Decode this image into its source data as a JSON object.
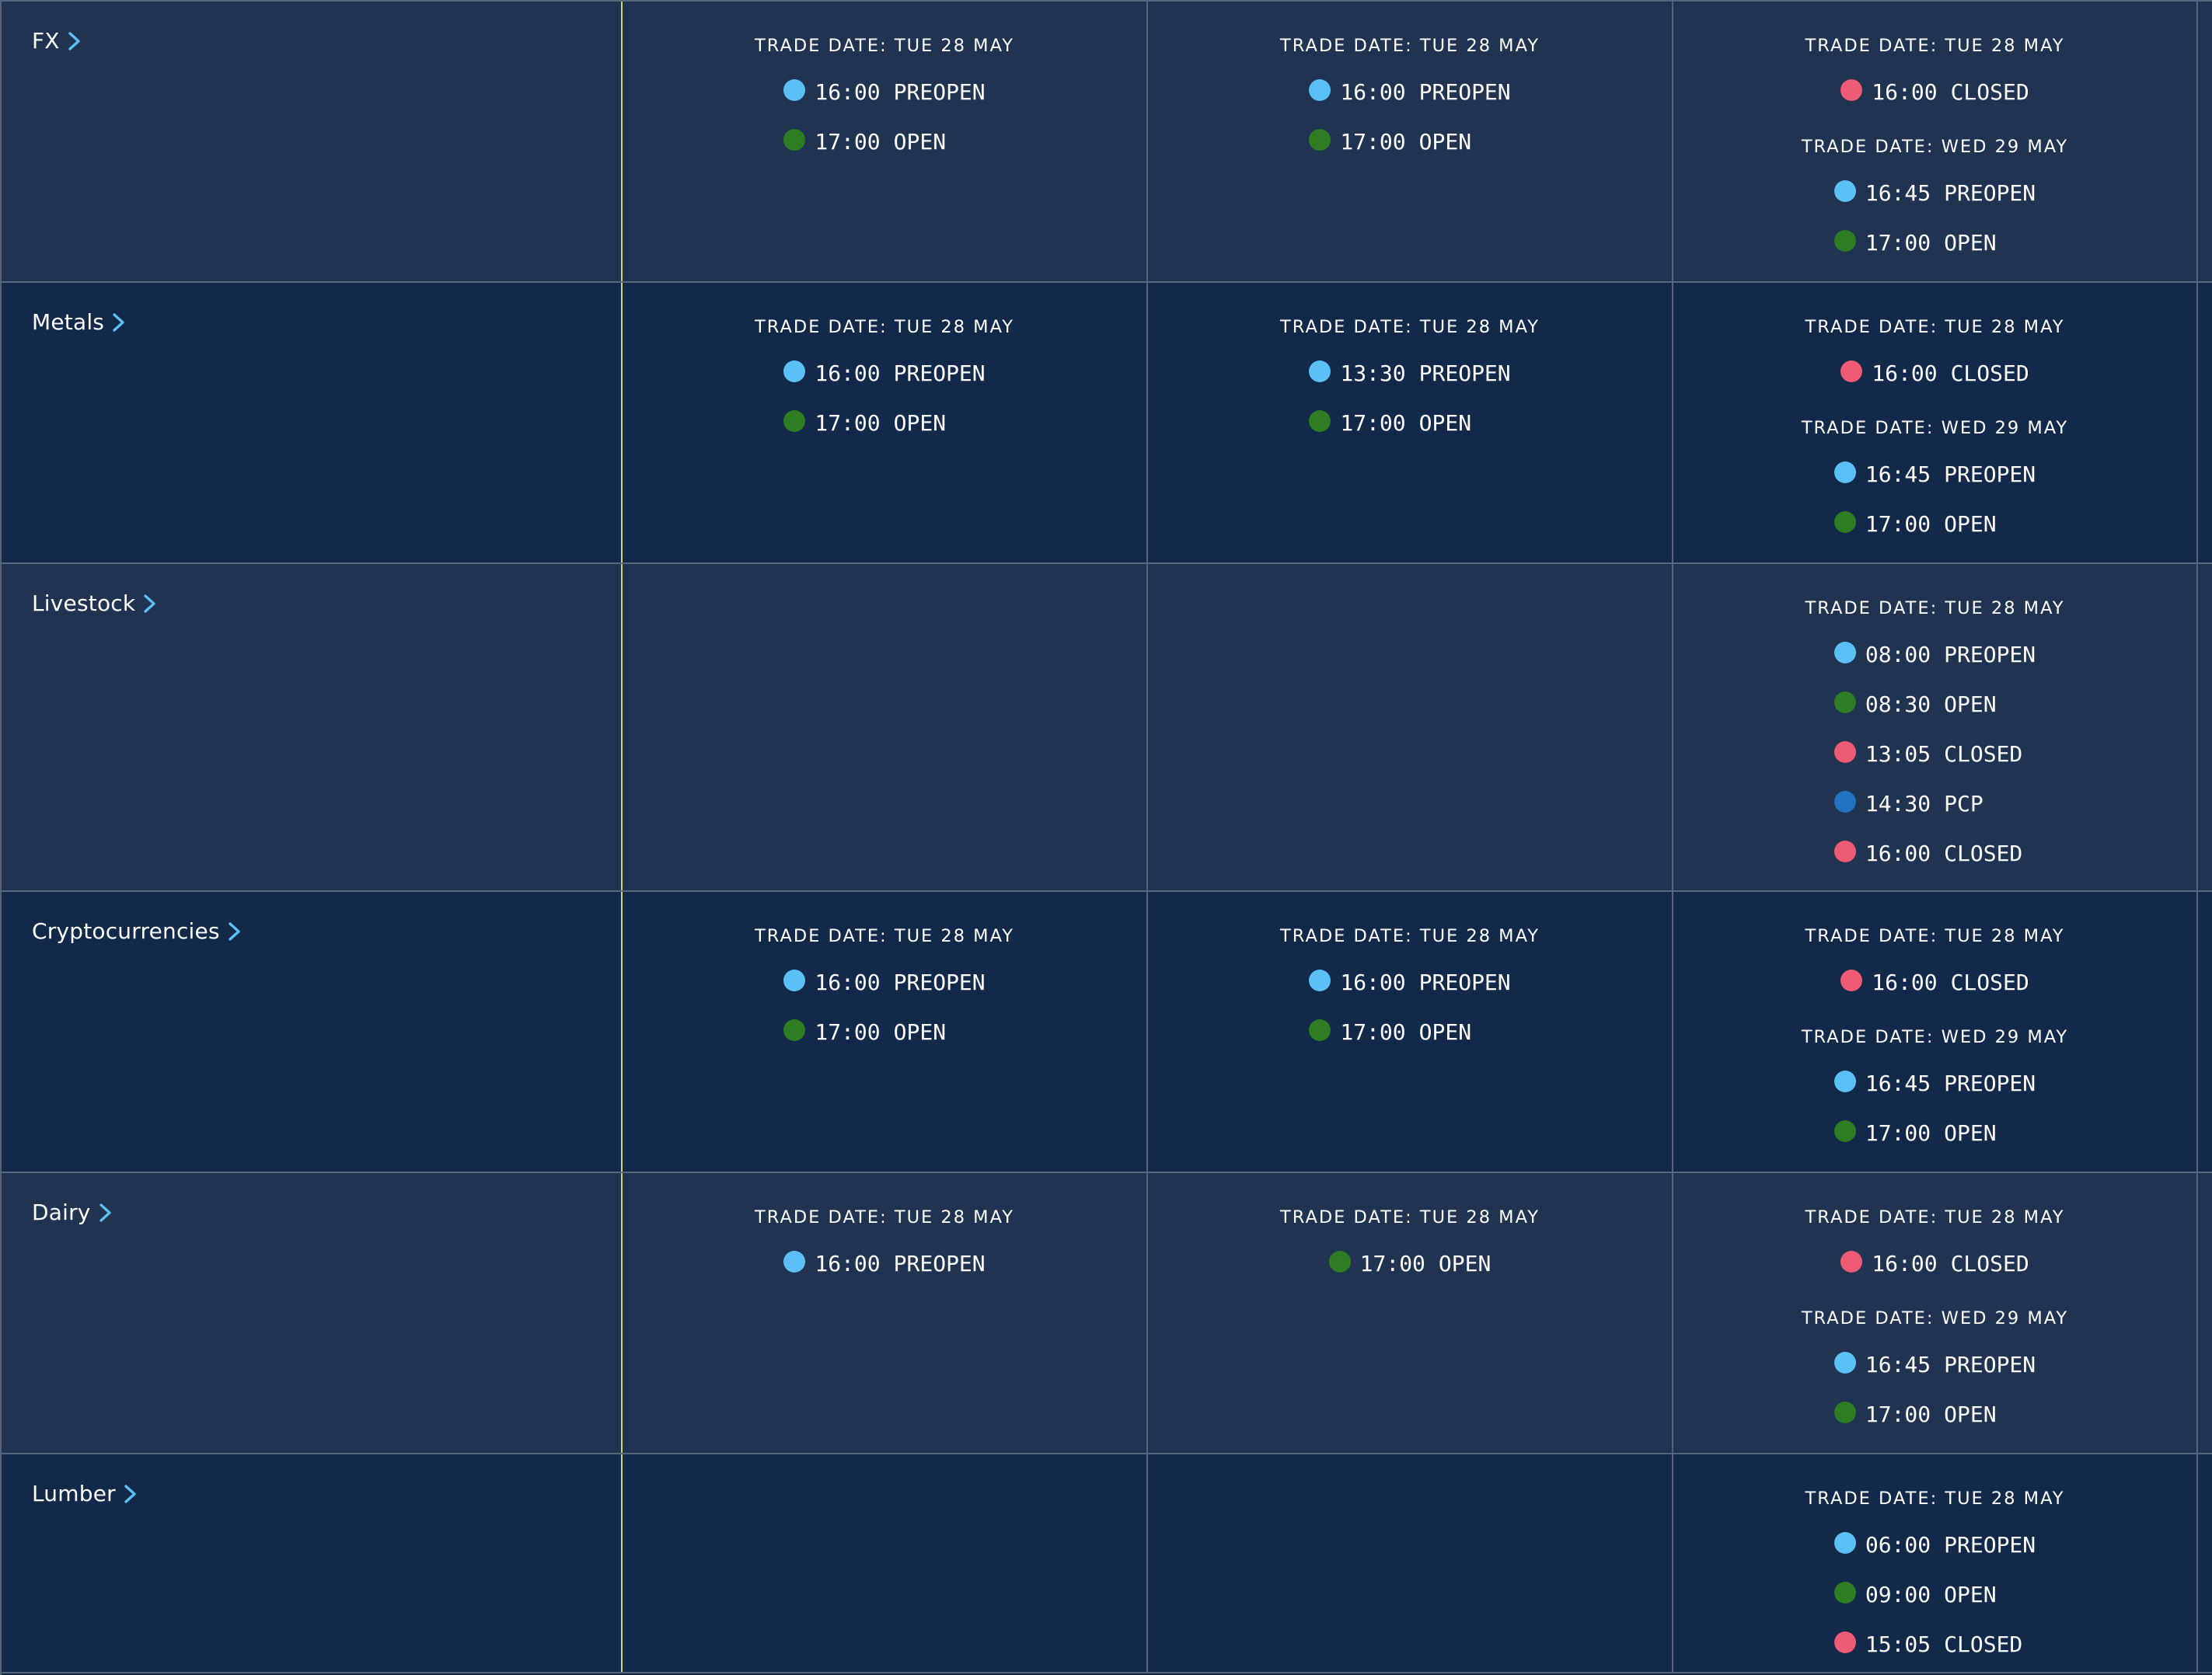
{
  "colors": {
    "PREOPEN": "#5bc0f5",
    "OPEN": "#2e7d22",
    "CLOSED": "#ef5a74",
    "PCP": "#1f73c0",
    "chevron": "#5bc0f5",
    "row_light": "#203351",
    "row_dark": "#13294a"
  },
  "rows": [
    {
      "category": "FX",
      "icon": "chevron-right-icon",
      "columns": [
        [
          {
            "trade_date": "TRADE DATE: TUE 28 MAY",
            "events": [
              {
                "time": "16:00",
                "status": "PREOPEN"
              },
              {
                "time": "17:00",
                "status": "OPEN"
              }
            ]
          }
        ],
        [
          {
            "trade_date": "TRADE DATE: TUE 28 MAY",
            "events": [
              {
                "time": "16:00",
                "status": "PREOPEN"
              },
              {
                "time": "17:00",
                "status": "OPEN"
              }
            ]
          }
        ],
        [
          {
            "trade_date": "TRADE DATE: TUE 28 MAY",
            "events": [
              {
                "time": "16:00",
                "status": "CLOSED"
              }
            ]
          },
          {
            "trade_date": "TRADE DATE: WED 29 MAY",
            "events": [
              {
                "time": "16:45",
                "status": "PREOPEN"
              },
              {
                "time": "17:00",
                "status": "OPEN"
              }
            ]
          }
        ]
      ]
    },
    {
      "category": "Metals",
      "icon": "chevron-right-icon",
      "columns": [
        [
          {
            "trade_date": "TRADE DATE: TUE 28 MAY",
            "events": [
              {
                "time": "16:00",
                "status": "PREOPEN"
              },
              {
                "time": "17:00",
                "status": "OPEN"
              }
            ]
          }
        ],
        [
          {
            "trade_date": "TRADE DATE: TUE 28 MAY",
            "events": [
              {
                "time": "13:30",
                "status": "PREOPEN"
              },
              {
                "time": "17:00",
                "status": "OPEN"
              }
            ]
          }
        ],
        [
          {
            "trade_date": "TRADE DATE: TUE 28 MAY",
            "events": [
              {
                "time": "16:00",
                "status": "CLOSED"
              }
            ]
          },
          {
            "trade_date": "TRADE DATE: WED 29 MAY",
            "events": [
              {
                "time": "16:45",
                "status": "PREOPEN"
              },
              {
                "time": "17:00",
                "status": "OPEN"
              }
            ]
          }
        ]
      ]
    },
    {
      "category": "Livestock",
      "icon": "chevron-right-icon",
      "columns": [
        [],
        [],
        [
          {
            "trade_date": "TRADE DATE: TUE 28 MAY",
            "events": [
              {
                "time": "08:00",
                "status": "PREOPEN"
              },
              {
                "time": "08:30",
                "status": "OPEN"
              },
              {
                "time": "13:05",
                "status": "CLOSED"
              },
              {
                "time": "14:30",
                "status": "PCP"
              },
              {
                "time": "16:00",
                "status": "CLOSED"
              }
            ]
          }
        ]
      ]
    },
    {
      "category": "Cryptocurrencies",
      "icon": "chevron-right-icon",
      "columns": [
        [
          {
            "trade_date": "TRADE DATE: TUE 28 MAY",
            "events": [
              {
                "time": "16:00",
                "status": "PREOPEN"
              },
              {
                "time": "17:00",
                "status": "OPEN"
              }
            ]
          }
        ],
        [
          {
            "trade_date": "TRADE DATE: TUE 28 MAY",
            "events": [
              {
                "time": "16:00",
                "status": "PREOPEN"
              },
              {
                "time": "17:00",
                "status": "OPEN"
              }
            ]
          }
        ],
        [
          {
            "trade_date": "TRADE DATE: TUE 28 MAY",
            "events": [
              {
                "time": "16:00",
                "status": "CLOSED"
              }
            ]
          },
          {
            "trade_date": "TRADE DATE: WED 29 MAY",
            "events": [
              {
                "time": "16:45",
                "status": "PREOPEN"
              },
              {
                "time": "17:00",
                "status": "OPEN"
              }
            ]
          }
        ]
      ]
    },
    {
      "category": "Dairy",
      "icon": "chevron-right-icon",
      "columns": [
        [
          {
            "trade_date": "TRADE DATE: TUE 28 MAY",
            "events": [
              {
                "time": "16:00",
                "status": "PREOPEN"
              }
            ]
          }
        ],
        [
          {
            "trade_date": "TRADE DATE: TUE 28 MAY",
            "events": [
              {
                "time": "17:00",
                "status": "OPEN"
              }
            ]
          }
        ],
        [
          {
            "trade_date": "TRADE DATE: TUE 28 MAY",
            "events": [
              {
                "time": "16:00",
                "status": "CLOSED"
              }
            ]
          },
          {
            "trade_date": "TRADE DATE: WED 29 MAY",
            "events": [
              {
                "time": "16:45",
                "status": "PREOPEN"
              },
              {
                "time": "17:00",
                "status": "OPEN"
              }
            ]
          }
        ]
      ]
    },
    {
      "category": "Lumber",
      "icon": "chevron-right-icon",
      "columns": [
        [],
        [],
        [
          {
            "trade_date": "TRADE DATE: TUE 28 MAY",
            "events": [
              {
                "time": "06:00",
                "status": "PREOPEN"
              },
              {
                "time": "09:00",
                "status": "OPEN"
              },
              {
                "time": "15:05",
                "status": "CLOSED"
              }
            ]
          }
        ]
      ]
    }
  ]
}
